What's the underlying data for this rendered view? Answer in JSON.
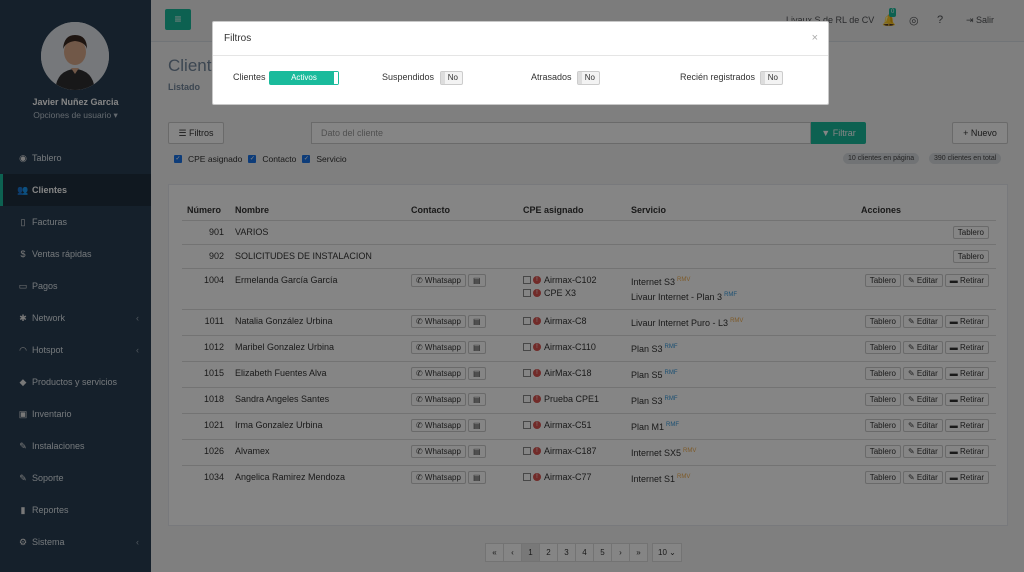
{
  "user": {
    "name": "Javier Nuñez Garcia",
    "options": "Opciones de usuario ▾"
  },
  "sidebar": {
    "items": [
      {
        "label": "Tablero",
        "icon": "dashboard-icon",
        "glyph": "◉"
      },
      {
        "label": "Clientes",
        "icon": "users-icon",
        "glyph": "👥"
      },
      {
        "label": "Facturas",
        "icon": "file-icon",
        "glyph": "▯"
      },
      {
        "label": "Ventas rápidas",
        "icon": "dollar-icon",
        "glyph": "$"
      },
      {
        "label": "Pagos",
        "icon": "money-icon",
        "glyph": "▭"
      },
      {
        "label": "Network",
        "icon": "network-icon",
        "glyph": "✱"
      },
      {
        "label": "Hotspot",
        "icon": "wifi-icon",
        "glyph": "◠"
      },
      {
        "label": "Productos y servicios",
        "icon": "tags-icon",
        "glyph": "◆"
      },
      {
        "label": "Inventario",
        "icon": "cubes-icon",
        "glyph": "▣"
      },
      {
        "label": "Instalaciones",
        "icon": "plug-icon",
        "glyph": "✎"
      },
      {
        "label": "Soporte",
        "icon": "wrench-icon",
        "glyph": "✎"
      },
      {
        "label": "Reportes",
        "icon": "book-icon",
        "glyph": "▮"
      },
      {
        "label": "Sistema",
        "icon": "cogs-icon",
        "glyph": "⚙"
      }
    ]
  },
  "topbar": {
    "menu_glyph": "≡",
    "company": "Livaux S de RL de CV",
    "notif_count": "0",
    "salir": "Salir"
  },
  "page": {
    "title": "Clientes",
    "subtitle": "Listado"
  },
  "toolbar": {
    "filtros": "☰ Filtros",
    "search_placeholder": "Dato del cliente",
    "filtrar": "▼ Filtrar",
    "nuevo": "+ Nuevo"
  },
  "checks": {
    "cpe": "CPE asignado",
    "contacto": "Contacto",
    "servicio": "Servicio"
  },
  "counts": {
    "page": "10 clientes en página",
    "total": "390 clientes en total"
  },
  "table": {
    "headers": [
      "Número",
      "Nombre",
      "Contacto",
      "CPE asignado",
      "Servicio",
      "Acciones"
    ],
    "rows": [
      {
        "num": "901",
        "name": "VARIOS"
      },
      {
        "num": "902",
        "name": "SOLICITUDES DE INSTALACION"
      },
      {
        "num": "1004",
        "name": "Ermelanda García García",
        "cpe": [
          "Airmax-C102",
          "CPE X3"
        ],
        "services": [
          {
            "name": "Internet S3",
            "tag": "RMV"
          },
          {
            "name": "Livaur Internet - Plan 3",
            "tag": "RMF"
          }
        ]
      },
      {
        "num": "1011",
        "name": "Natalia González Urbina",
        "cpe": [
          "Airmax-C8"
        ],
        "services": [
          {
            "name": "Livaur Internet Puro - L3",
            "tag": "RMV"
          }
        ]
      },
      {
        "num": "1012",
        "name": "Maribel Gonzalez Urbina",
        "cpe": [
          "Airmax-C110"
        ],
        "services": [
          {
            "name": "Plan S3",
            "tag": "RMF"
          }
        ]
      },
      {
        "num": "1015",
        "name": "Elizabeth Fuentes Alva",
        "cpe": [
          "AirMax-C18"
        ],
        "services": [
          {
            "name": "Plan S5",
            "tag": "RMF"
          }
        ]
      },
      {
        "num": "1018",
        "name": "Sandra Angeles Santes",
        "cpe": [
          "Prueba CPE1"
        ],
        "services": [
          {
            "name": "Plan S3",
            "tag": "RMF"
          }
        ]
      },
      {
        "num": "1021",
        "name": "Irma Gonzalez Urbina",
        "cpe": [
          "Airmax-C51"
        ],
        "services": [
          {
            "name": "Plan M1",
            "tag": "RMF"
          }
        ]
      },
      {
        "num": "1026",
        "name": "Alvamex",
        "cpe": [
          "Airmax-C187"
        ],
        "services": [
          {
            "name": "Internet SX5",
            "tag": "RMV"
          }
        ]
      },
      {
        "num": "1034",
        "name": "Angelica Ramirez Mendoza",
        "cpe": [
          "Airmax-C77"
        ],
        "services": [
          {
            "name": "Internet S1",
            "tag": "RMV"
          }
        ]
      }
    ],
    "whatsapp": "✆ Whatsapp",
    "card_glyph": "▤",
    "tablero": "Tablero",
    "editar": "✎ Editar",
    "retirar": "▬ Retirar"
  },
  "pager": [
    "«",
    "‹",
    "1",
    "2",
    "3",
    "4",
    "5",
    "›",
    "»",
    "10 ⌄"
  ],
  "modal": {
    "title": "Filtros",
    "close": "×",
    "filters": [
      {
        "label": "Clientes",
        "value": "Activos"
      },
      {
        "label": "Suspendidos",
        "value": "No"
      },
      {
        "label": "Atrasados",
        "value": "No"
      },
      {
        "label": "Recién registrados",
        "value": "No"
      }
    ]
  },
  "colors": {
    "accent": "#1abb9c",
    "sidebar": "#2a3f54",
    "rmv": "#f0ad4e",
    "rmf": "#3498db"
  }
}
